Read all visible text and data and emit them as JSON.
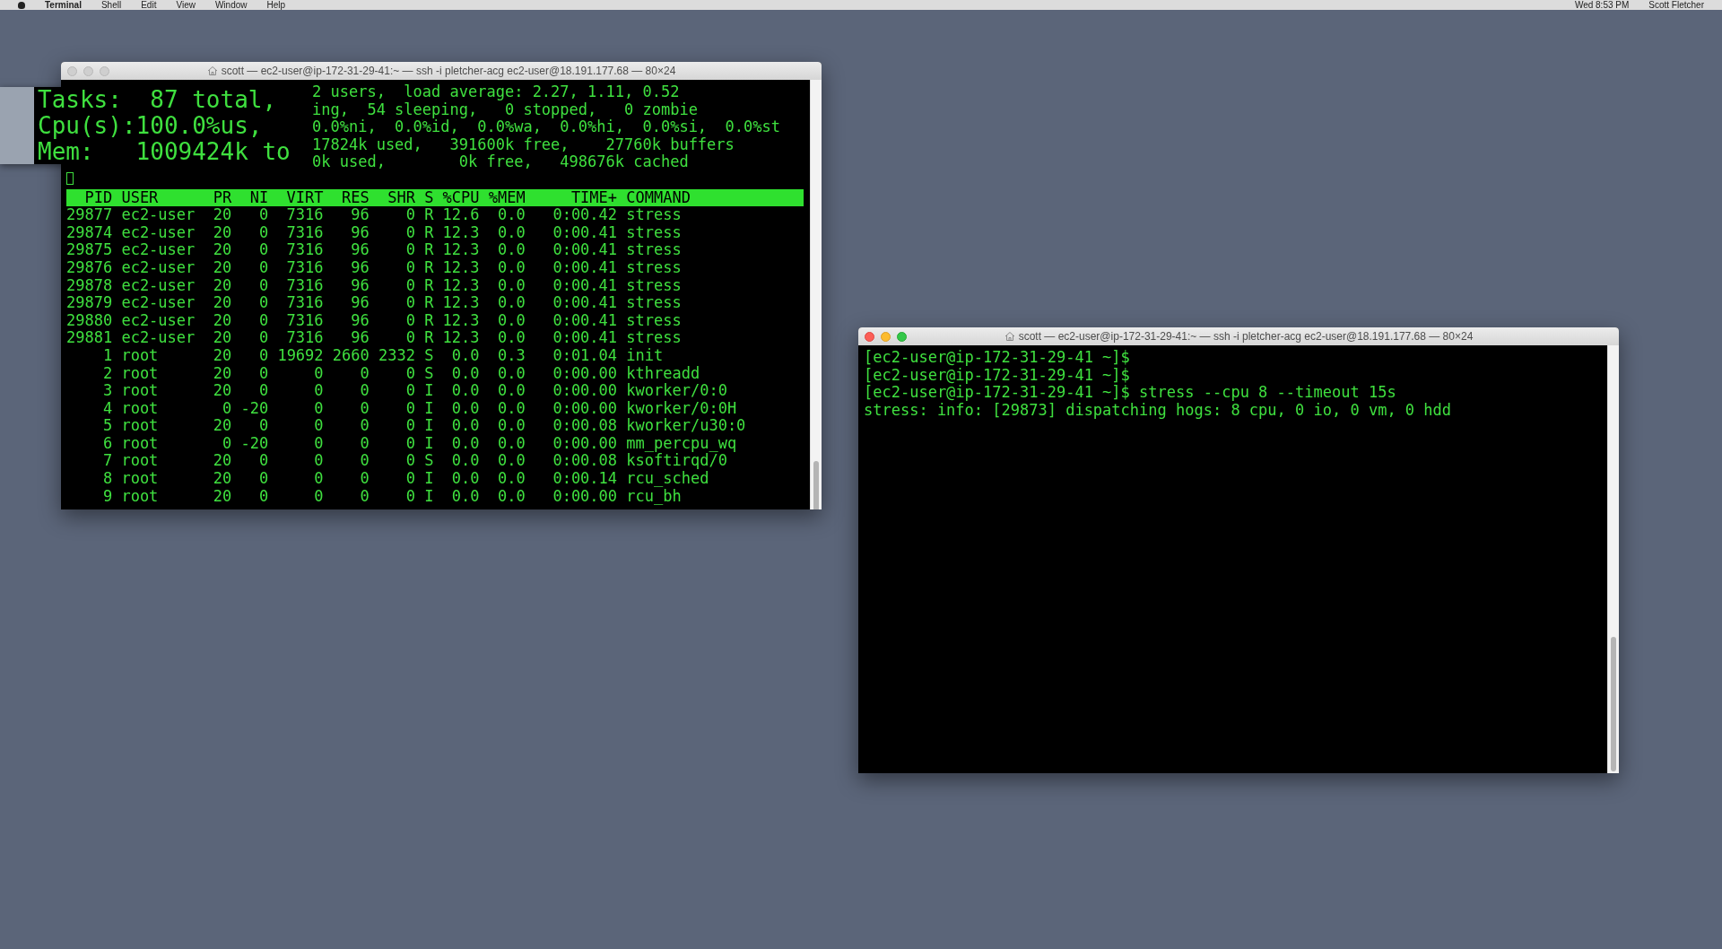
{
  "menu_bar": {
    "app_menus": [
      "Terminal",
      "Shell",
      "Edit",
      "View",
      "Window",
      "Help"
    ],
    "clock": "Wed 8:53 PM",
    "user": "Scott Fletcher"
  },
  "windows": [
    {
      "kind": "top",
      "active": false,
      "title": "scott — ec2-user@ip-172-31-29-41:~ — ssh -i pletcher-acg ec2-user@18.191.177.68 — 80×24",
      "magnifier": [
        "Tasks:  87 total,",
        "Cpu(s):100.0%us,",
        "Mem:   1009424k to"
      ],
      "header_lines": [
        "2 users,  load average: 2.27, 1.11, 0.52",
        "ing,  54 sleeping,   0 stopped,   0 zombie",
        "0.0%ni,  0.0%id,  0.0%wa,  0.0%hi,  0.0%si,  0.0%st",
        "17824k used,   391600k free,    27760k buffers",
        "0k used,        0k free,   498676k cached"
      ],
      "columns": [
        "PID",
        "USER",
        "PR",
        "NI",
        "VIRT",
        "RES",
        "SHR",
        "S",
        "%CPU",
        "%MEM",
        "TIME+",
        "COMMAND"
      ],
      "rows": [
        [
          "29877",
          "ec2-user",
          "20",
          "0",
          "7316",
          "96",
          "0",
          "R",
          "12.6",
          "0.0",
          "0:00.42",
          "stress"
        ],
        [
          "29874",
          "ec2-user",
          "20",
          "0",
          "7316",
          "96",
          "0",
          "R",
          "12.3",
          "0.0",
          "0:00.41",
          "stress"
        ],
        [
          "29875",
          "ec2-user",
          "20",
          "0",
          "7316",
          "96",
          "0",
          "R",
          "12.3",
          "0.0",
          "0:00.41",
          "stress"
        ],
        [
          "29876",
          "ec2-user",
          "20",
          "0",
          "7316",
          "96",
          "0",
          "R",
          "12.3",
          "0.0",
          "0:00.41",
          "stress"
        ],
        [
          "29878",
          "ec2-user",
          "20",
          "0",
          "7316",
          "96",
          "0",
          "R",
          "12.3",
          "0.0",
          "0:00.41",
          "stress"
        ],
        [
          "29879",
          "ec2-user",
          "20",
          "0",
          "7316",
          "96",
          "0",
          "R",
          "12.3",
          "0.0",
          "0:00.41",
          "stress"
        ],
        [
          "29880",
          "ec2-user",
          "20",
          "0",
          "7316",
          "96",
          "0",
          "R",
          "12.3",
          "0.0",
          "0:00.41",
          "stress"
        ],
        [
          "29881",
          "ec2-user",
          "20",
          "0",
          "7316",
          "96",
          "0",
          "R",
          "12.3",
          "0.0",
          "0:00.41",
          "stress"
        ],
        [
          "1",
          "root",
          "20",
          "0",
          "19692",
          "2660",
          "2332",
          "S",
          "0.0",
          "0.3",
          "0:01.04",
          "init"
        ],
        [
          "2",
          "root",
          "20",
          "0",
          "0",
          "0",
          "0",
          "S",
          "0.0",
          "0.0",
          "0:00.00",
          "kthreadd"
        ],
        [
          "3",
          "root",
          "20",
          "0",
          "0",
          "0",
          "0",
          "I",
          "0.0",
          "0.0",
          "0:00.00",
          "kworker/0:0"
        ],
        [
          "4",
          "root",
          "0",
          "-20",
          "0",
          "0",
          "0",
          "I",
          "0.0",
          "0.0",
          "0:00.00",
          "kworker/0:0H"
        ],
        [
          "5",
          "root",
          "20",
          "0",
          "0",
          "0",
          "0",
          "I",
          "0.0",
          "0.0",
          "0:00.08",
          "kworker/u30:0"
        ],
        [
          "6",
          "root",
          "0",
          "-20",
          "0",
          "0",
          "0",
          "I",
          "0.0",
          "0.0",
          "0:00.00",
          "mm_percpu_wq"
        ],
        [
          "7",
          "root",
          "20",
          "0",
          "0",
          "0",
          "0",
          "S",
          "0.0",
          "0.0",
          "0:00.08",
          "ksoftirqd/0"
        ],
        [
          "8",
          "root",
          "20",
          "0",
          "0",
          "0",
          "0",
          "I",
          "0.0",
          "0.0",
          "0:00.14",
          "rcu_sched"
        ],
        [
          "9",
          "root",
          "20",
          "0",
          "0",
          "0",
          "0",
          "I",
          "0.0",
          "0.0",
          "0:00.00",
          "rcu_bh"
        ]
      ]
    },
    {
      "kind": "shell",
      "active": true,
      "title": "scott — ec2-user@ip-172-31-29-41:~ — ssh -i pletcher-acg ec2-user@18.191.177.68 — 80×24",
      "lines": [
        "[ec2-user@ip-172-31-29-41 ~]$",
        "[ec2-user@ip-172-31-29-41 ~]$",
        "[ec2-user@ip-172-31-29-41 ~]$ stress --cpu 8 --timeout 15s",
        "stress: info: [29873] dispatching hogs: 8 cpu, 0 io, 0 vm, 0 hdd"
      ]
    }
  ]
}
